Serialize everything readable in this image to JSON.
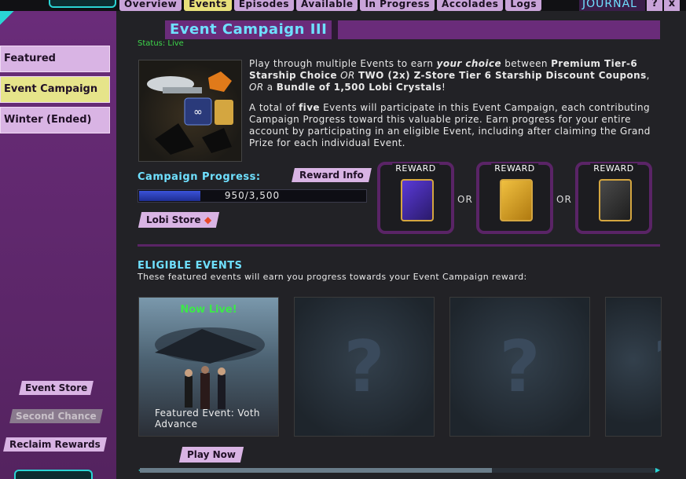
{
  "top_tabs": [
    "Overview",
    "Events",
    "Episodes",
    "Available",
    "In Progress",
    "Accolades",
    "Logs"
  ],
  "journal": {
    "label": "JOURNAL",
    "help": "?",
    "close": "x"
  },
  "sidebar": {
    "items": [
      "Featured",
      "Event Campaign",
      "Winter (Ended)"
    ],
    "buttons": {
      "event_store": "Event Store",
      "second_chance": "Second Chance",
      "reclaim": "Reclaim Rewards"
    }
  },
  "main": {
    "title": "Event Campaign III",
    "status": "Status: Live",
    "description": {
      "p1_a": "Play through multiple Events to earn ",
      "p1_b": "your choice",
      "p1_c": " between ",
      "p1_d": "Premium Tier-6 Starship Choice",
      "p1_e": " OR ",
      "p1_f": "TWO (2x) Z-Store Tier 6 Starship Discount Coupons",
      "p1_g": ", ",
      "p1_h": "OR",
      "p1_i": " a ",
      "p1_j": "Bundle of 1,500 Lobi Crystals",
      "p1_k": "!",
      "p2_a": "A total of ",
      "p2_b": "five",
      "p2_c": " Events will participate in this Event Campaign, each contributing Campaign Progress toward this valuable prize. Earn progress for your entire account by participating in an eligible Event, including after claiming the Grand Prize for each individual Event."
    },
    "campaign_progress_label": "Campaign Progress:",
    "reward_info": "Reward Info",
    "progress": {
      "text": "950/3,500",
      "fraction": 0.2714
    },
    "lobi_store": "Lobi Store",
    "rewards": {
      "label": "REWARD",
      "or": "OR"
    },
    "eligible_title": "ELIGIBLE EVENTS",
    "eligible_sub": "These featured events will earn you progress towards your Event Campaign reward:",
    "featured_card": {
      "live": "Now Live!",
      "caption": "Featured Event: Voth Advance"
    },
    "unknown_mark": "?",
    "play_now": "Play Now"
  },
  "colors": {
    "accent_cyan": "#6fe0ff",
    "purple": "#6a2c7a",
    "pill": "#d9b4e4",
    "live_green": "#3de84a"
  }
}
